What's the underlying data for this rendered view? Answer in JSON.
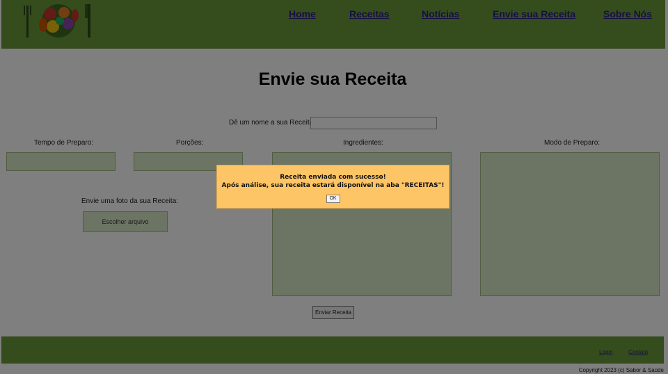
{
  "header": {
    "logo_alt": "Sabor & Saúde",
    "nav": [
      "Home",
      "Receitas",
      "Notícias",
      "Envie sua Receita",
      "Sobre Nós"
    ]
  },
  "main": {
    "title": "Envie sua Receita",
    "name_label": "Dê um nome a sua Receita:",
    "prep_time_label": "Tempo de Preparo:",
    "portions_label": "Porções:",
    "ingredients_label": "Ingredientes:",
    "method_label": "Modo de Preparo:",
    "photo_label": "Envie uma foto da sua Receita:",
    "file_button": "Escolher arquivo",
    "submit_button": "Enviar Receita"
  },
  "footer": {
    "login": "Login",
    "contact": "Contato",
    "copyright": "Copyright 2023 (c) Sabor & Saúde"
  },
  "dialog": {
    "line1": "Receita enviada com sucesso!",
    "line2": "Após análise, sua receita estará disponível na aba \"RECEITAS\"!",
    "ok": "OK"
  },
  "colors": {
    "header_bg": "#6a9b3a",
    "link": "#2a1d8a",
    "field_bg": "#d9e9c8",
    "dialog_bg": "#fdc566"
  }
}
